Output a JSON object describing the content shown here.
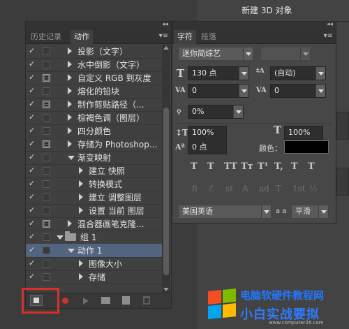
{
  "background": {
    "dialog_title": "新建 3D 对象"
  },
  "actions_panel": {
    "tabs": [
      {
        "label": "历史记录",
        "active": false
      },
      {
        "label": "动作",
        "active": true
      }
    ],
    "rows": [
      {
        "checked": true,
        "dialog": false,
        "indent": 1,
        "expand": "right",
        "label": "投影（文字）"
      },
      {
        "checked": true,
        "dialog": false,
        "indent": 1,
        "expand": "right",
        "label": "水中倒影（文字）"
      },
      {
        "checked": true,
        "dialog": true,
        "indent": 1,
        "expand": "right",
        "label": "自定义 RGB 到灰度"
      },
      {
        "checked": true,
        "dialog": false,
        "indent": 1,
        "expand": "right",
        "label": "熔化的铅块"
      },
      {
        "checked": true,
        "dialog": true,
        "indent": 1,
        "expand": "right",
        "label": "制作剪贴路径（..."
      },
      {
        "checked": true,
        "dialog": false,
        "indent": 1,
        "expand": "right",
        "label": "棕褐色调（图层）"
      },
      {
        "checked": true,
        "dialog": false,
        "indent": 1,
        "expand": "right",
        "label": "四分颜色"
      },
      {
        "checked": true,
        "dialog": true,
        "indent": 1,
        "expand": "right",
        "label": "存储为 Photoshop..."
      },
      {
        "checked": true,
        "dialog": false,
        "indent": 1,
        "expand": "down",
        "label": "渐变映射"
      },
      {
        "checked": true,
        "dialog": false,
        "indent": 2,
        "expand": "right",
        "label": "建立 快照"
      },
      {
        "checked": true,
        "dialog": false,
        "indent": 2,
        "expand": "right",
        "label": "转换模式"
      },
      {
        "checked": true,
        "dialog": false,
        "indent": 2,
        "expand": "right",
        "label": "建立 调整图层"
      },
      {
        "checked": true,
        "dialog": false,
        "indent": 2,
        "expand": "right",
        "label": "设置 当前 图层"
      },
      {
        "checked": true,
        "dialog": true,
        "indent": 1,
        "expand": "right",
        "label": "混合器画笔克隆..."
      },
      {
        "checked": true,
        "dialog": false,
        "indent": 0,
        "expand": "down",
        "label": "组 1",
        "folder": true
      },
      {
        "checked": true,
        "dialog": false,
        "indent": 1,
        "expand": "down",
        "label": "动作 1",
        "selected": true
      },
      {
        "checked": true,
        "dialog": false,
        "indent": 2,
        "expand": "right",
        "label": "图像大小"
      },
      {
        "checked": true,
        "dialog": false,
        "indent": 2,
        "expand": "right",
        "label": "存储"
      }
    ],
    "toolbar_icons": [
      "stop-icon",
      "record-icon",
      "play-icon",
      "new-set-icon",
      "new-action-icon",
      "delete-icon"
    ]
  },
  "character_panel": {
    "tabs": [
      {
        "label": "字符",
        "active": true
      },
      {
        "label": "段落",
        "active": false
      }
    ],
    "font_family": "迷你简综艺",
    "font_style": "-",
    "font_size": "130 点",
    "leading": "(自动)",
    "kerning": "0",
    "tracking": "0",
    "tsume": "0%",
    "vertical_scale": "100%",
    "horizontal_scale": "100%",
    "baseline_shift": "0 点",
    "color_label": "颜色：",
    "text_color": "#000000",
    "style_buttons": [
      "T",
      "T",
      "TT",
      "Tт",
      "T¹",
      "T,",
      "T",
      "T"
    ],
    "opentype_buttons": [
      "fi",
      "ℰ",
      "st",
      "A",
      "ad",
      "T",
      "1st",
      "½"
    ],
    "language": "美国英语",
    "aa_icon": "a a",
    "antialias": "平滑"
  },
  "watermark": {
    "line1": "电脑软硬件教程网",
    "line2": "小白实战要拟",
    "url": "www.computer26.com",
    "logo_colors": [
      "#f25022",
      "#7fba00",
      "#00a4ef",
      "#ffb900"
    ]
  }
}
